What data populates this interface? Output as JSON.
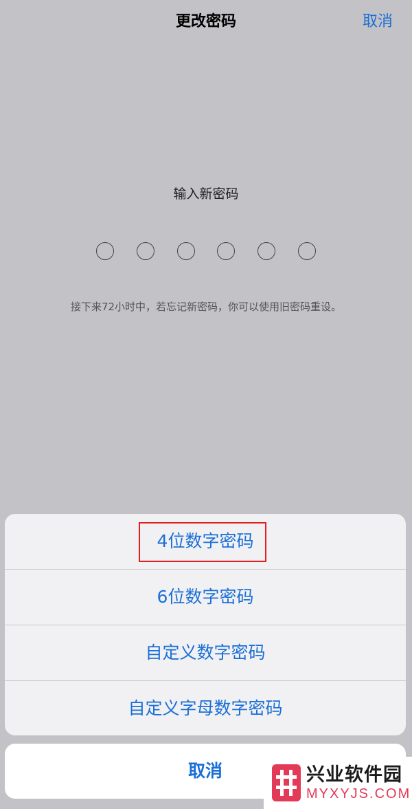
{
  "header": {
    "title": "更改密码",
    "cancel_label": "取消"
  },
  "passcode": {
    "prompt": "输入新密码",
    "digit_count": 6,
    "hint": "接下来72小时中，若忘记新密码，你可以使用旧密码重设。"
  },
  "action_sheet": {
    "options": [
      {
        "label": "4位数字密码",
        "highlighted": true
      },
      {
        "label": "6位数字密码"
      },
      {
        "label": "自定义数字密码"
      },
      {
        "label": "自定义字母数字密码"
      }
    ],
    "cancel_label": "取消"
  },
  "watermark": {
    "name": "兴业软件园",
    "domain": "MYXYJS.COM"
  },
  "colors": {
    "accent": "#1a6fd6",
    "highlight_border": "#e02020",
    "backdrop": "#c3c3c7",
    "sheet_background": "#f1f1f3",
    "watermark_accent": "#e23a57"
  }
}
